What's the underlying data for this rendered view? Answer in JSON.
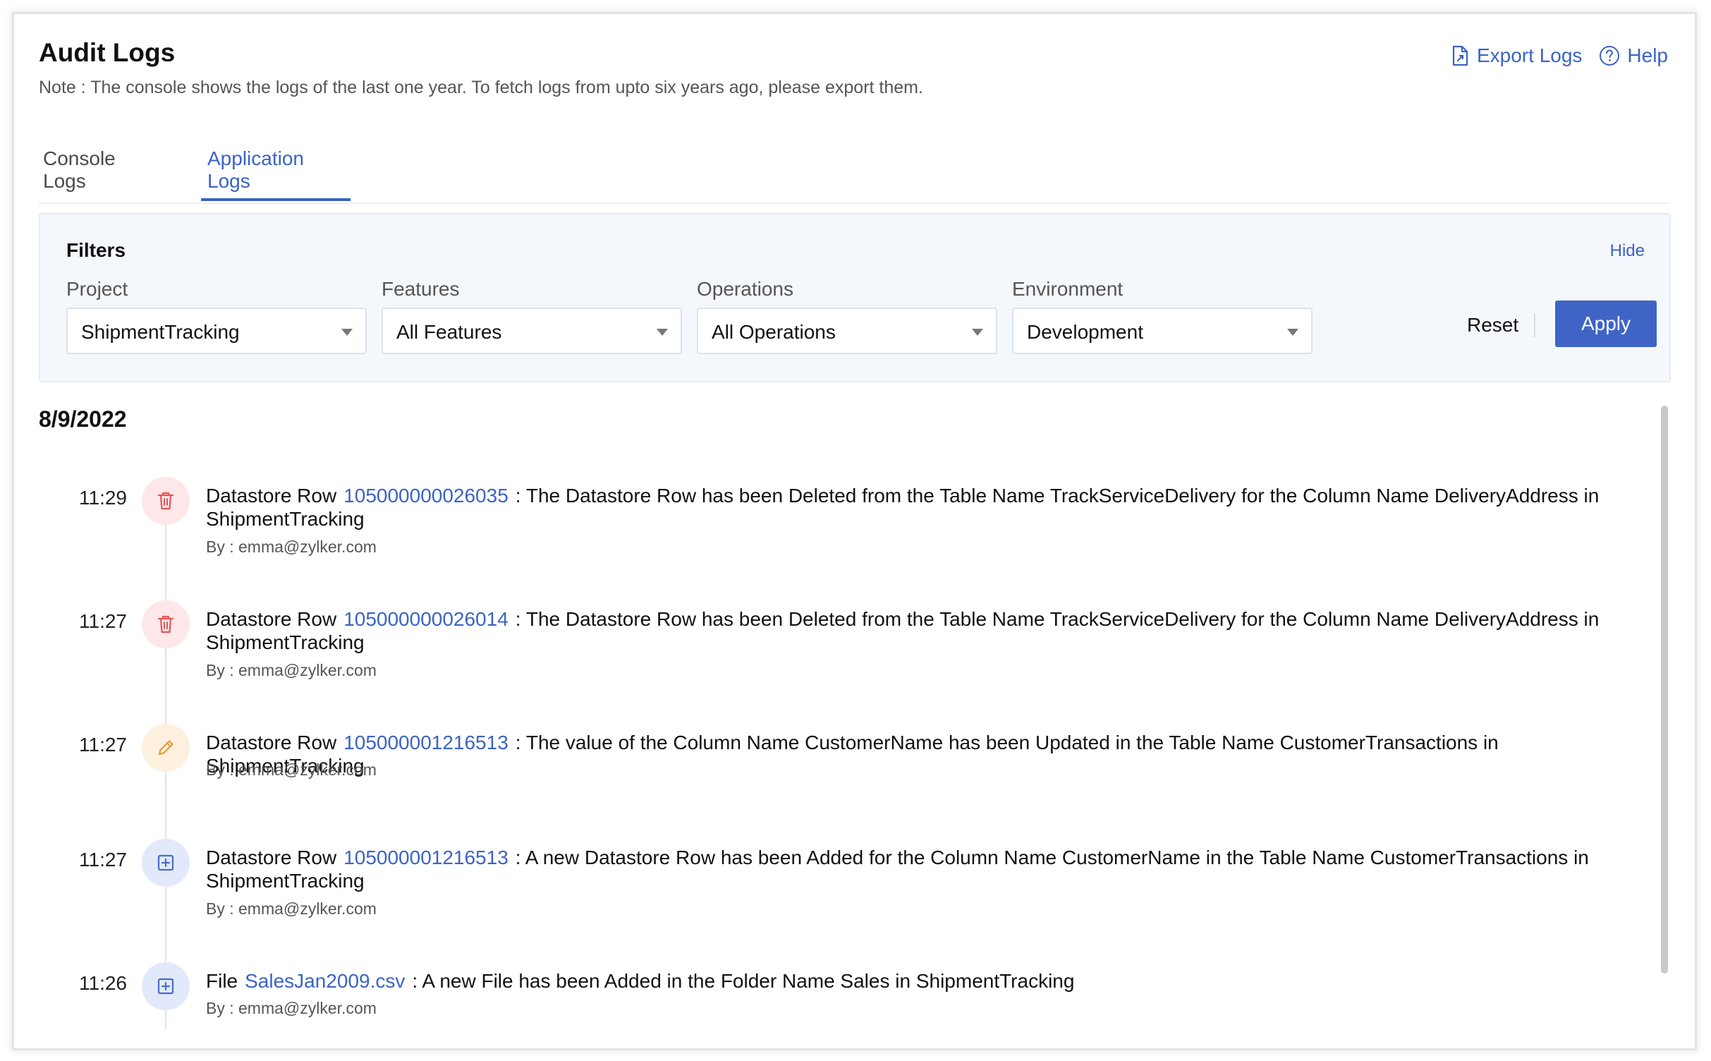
{
  "header": {
    "title": "Audit Logs",
    "note": "Note : The console shows the logs of the last one year. To fetch logs from upto six years ago, please export them.",
    "export_label": "Export Logs",
    "help_label": "Help"
  },
  "tabs": [
    {
      "label": "Console Logs",
      "active": false
    },
    {
      "label": "Application Logs",
      "active": true
    }
  ],
  "filters": {
    "title": "Filters",
    "hide_label": "Hide",
    "fields": [
      {
        "label": "Project",
        "value": "ShipmentTracking"
      },
      {
        "label": "Features",
        "value": "All Features"
      },
      {
        "label": "Operations",
        "value": "All Operations"
      },
      {
        "label": "Environment",
        "value": "Development"
      }
    ],
    "reset_label": "Reset",
    "apply_label": "Apply"
  },
  "date": "8/9/2022",
  "logs": [
    {
      "time": "11:29",
      "type": "delete",
      "icon": "trash-icon",
      "subject": "Datastore Row",
      "ref": "105000000026035",
      "message_line1": ": The Datastore Row has been Deleted from the Table Name TrackServiceDelivery for the Column Name DeliveryAddress in",
      "message_line2": "ShipmentTracking",
      "by": "By : emma@zylker.com"
    },
    {
      "time": "11:27",
      "type": "delete",
      "icon": "trash-icon",
      "subject": "Datastore Row",
      "ref": "105000000026014",
      "message_line1": ": The Datastore Row has been Deleted from the Table Name TrackServiceDelivery for the Column Name DeliveryAddress in",
      "message_line2": "ShipmentTracking",
      "by": "By : emma@zylker.com"
    },
    {
      "time": "11:27",
      "type": "update",
      "icon": "pencil-icon",
      "subject": "Datastore Row",
      "ref": "105000001216513",
      "message_line1": ": The value of the Column Name CustomerName has been Updated in the Table Name CustomerTransactions in ShipmentTracking",
      "message_line2": "",
      "by": "By : emma@zylker.com"
    },
    {
      "time": "11:27",
      "type": "add",
      "icon": "plus-square-icon",
      "subject": "Datastore Row",
      "ref": "105000001216513",
      "message_line1": ": A new Datastore Row has been Added for the Column Name CustomerName in the Table Name CustomerTransactions in",
      "message_line2": "ShipmentTracking",
      "by": "By : emma@zylker.com"
    },
    {
      "time": "11:26",
      "type": "add",
      "icon": "plus-square-icon",
      "subject": "File",
      "ref": "SalesJan2009.csv",
      "message_line1": ": A new File has been Added in the Folder Name Sales in ShipmentTracking",
      "message_line2": "",
      "by": "By : emma@zylker.com"
    }
  ],
  "colors": {
    "accent": "#3a63c5",
    "apply_button": "#3f64c6",
    "delete_bg": "#fde7e8",
    "delete_fg": "#e0565b",
    "update_bg": "#fdf0de",
    "update_fg": "#e59a3c",
    "add_bg": "#e2e9fa",
    "add_fg": "#4a6cc9"
  }
}
